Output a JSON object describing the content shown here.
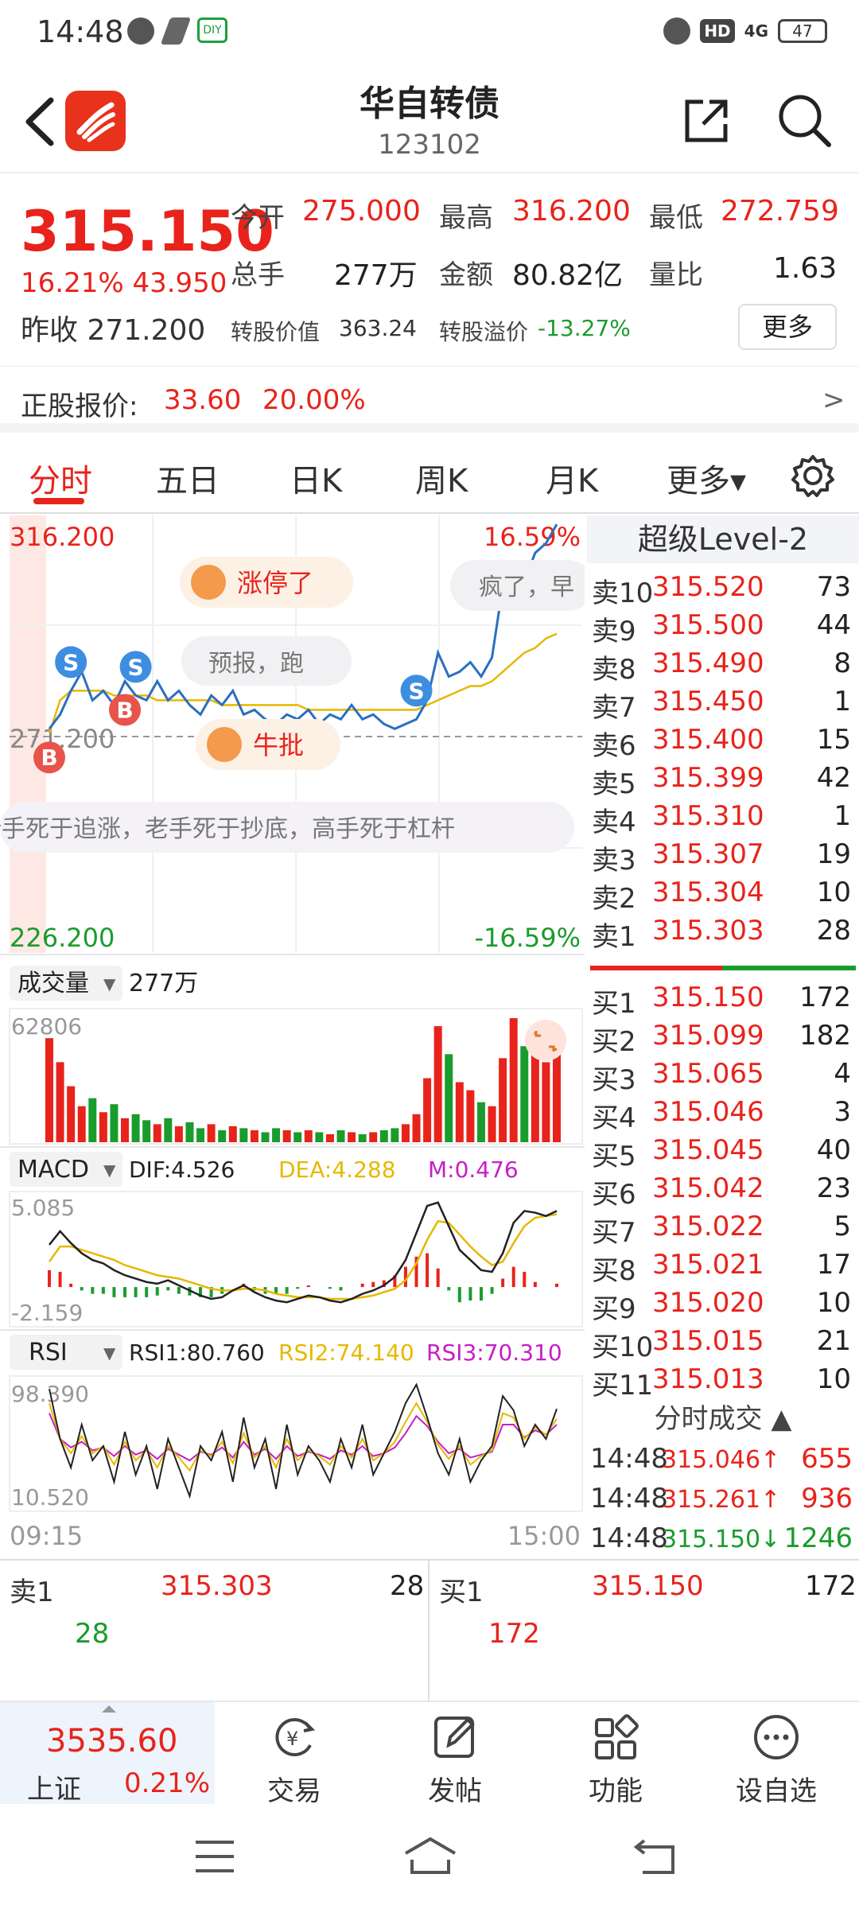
{
  "status_bar": {
    "time": "14:48",
    "battery": "47",
    "network": "4G",
    "hd": "HD"
  },
  "header": {
    "title": "华自转债",
    "code": "123102"
  },
  "quote": {
    "price": "315.150",
    "change_pct": "16.21%",
    "change_abs": "43.950",
    "prev_close_label": "昨收",
    "prev_close": "271.200",
    "open_label": "今开",
    "open": "275.000",
    "high_label": "最高",
    "high": "316.200",
    "low_label": "最低",
    "low": "272.759",
    "volume_label": "总手",
    "volume": "277万",
    "amount_label": "金额",
    "amount": "80.82亿",
    "ratio_label": "量比",
    "ratio": "1.63",
    "conv_value_label": "转股价值",
    "conv_value": "363.24",
    "premium_label": "转股溢价",
    "premium": "-13.27%",
    "more_label": "更多"
  },
  "underlying": {
    "label": "正股报价:",
    "price": "33.60",
    "pct": "20.00%",
    "arrow": ">"
  },
  "tabs": [
    {
      "label": "分时"
    },
    {
      "label": "五日"
    },
    {
      "label": "日K"
    },
    {
      "label": "周K"
    },
    {
      "label": "月K"
    },
    {
      "label": "更多▾"
    }
  ],
  "colors": {
    "up": "#e8231b",
    "down": "#1a9c2c",
    "price_line": "#2b6fc0",
    "avg_line": "#e6b800",
    "macd_dea": "#e6b800",
    "macd_m": "#c61ec6"
  },
  "chart_data": [
    {
      "type": "line",
      "title": "",
      "y_top_label": "316.200",
      "y_mid_label": "271.200",
      "y_bottom_label": "226.200",
      "pct_top_label": "16.59%",
      "pct_bottom_label": "-16.59%",
      "x_start_label": "09:15",
      "x_end_label": "15:00",
      "ylim": [
        226.2,
        316.2
      ],
      "series": [
        {
          "values": [
            273,
            276,
            281,
            285,
            279,
            281,
            278,
            283,
            280,
            279,
            283,
            279,
            281,
            278,
            276,
            280,
            278,
            281,
            276,
            277,
            275,
            274,
            276,
            275,
            277,
            274,
            276,
            275,
            278,
            275,
            276,
            274,
            273,
            274,
            275,
            279,
            289,
            284,
            285,
            287,
            284,
            288,
            303,
            308,
            304,
            310,
            312,
            316
          ]
        },
        {
          "values": [
            272,
            279,
            281,
            281,
            281,
            281,
            280,
            280,
            280,
            280,
            279,
            279,
            279,
            279,
            279,
            279,
            278,
            278,
            278,
            278,
            278,
            278,
            278,
            278,
            277,
            277,
            277,
            277,
            277,
            277,
            277,
            277,
            277,
            277,
            277,
            278,
            279,
            280,
            281,
            282,
            282,
            283,
            285,
            287,
            289,
            290,
            292,
            293
          ]
        }
      ],
      "markers": [
        {
          "label": "B",
          "index": 0
        },
        {
          "label": "S",
          "index": 2
        },
        {
          "label": "B",
          "index": 7
        },
        {
          "label": "S",
          "index": 8
        },
        {
          "label": "B",
          "index": 25
        },
        {
          "label": "S",
          "index": 34
        }
      ],
      "overlays": [
        "涨停了",
        "预报，跑",
        "牛批",
        "疯了，早",
        "新手死于追涨，老手死于抄底，高手死于杠杆"
      ]
    },
    {
      "type": "bar",
      "selector_label": "成交量",
      "total_label": "277万",
      "y_top_label": "62806",
      "values": [
        52000,
        40000,
        28000,
        18000,
        22000,
        15000,
        19000,
        12000,
        14000,
        11000,
        9000,
        12000,
        8000,
        10000,
        7000,
        9000,
        6000,
        8000,
        7000,
        6000,
        5000,
        7000,
        6000,
        5000,
        6000,
        5000,
        4000,
        6000,
        5000,
        4000,
        5000,
        6000,
        7000,
        9000,
        14000,
        32000,
        58000,
        44000,
        30000,
        26000,
        20000,
        18000,
        42000,
        62000,
        48000,
        55000,
        40000,
        50000
      ]
    },
    {
      "type": "line",
      "selector_label": "MACD",
      "dif_label": "DIF:4.526",
      "dea_label": "DEA:4.288",
      "m_label": "M:0.476",
      "y_top_label": "5.085",
      "y_bottom_label": "-2.159",
      "ylim": [
        -2.159,
        5.085
      ],
      "series": [
        {
          "name": "DIF",
          "values": [
            2.5,
            3.3,
            2.6,
            2.0,
            1.6,
            1.4,
            1.0,
            0.7,
            0.5,
            0.3,
            0.2,
            0.4,
            0.1,
            -0.2,
            -0.5,
            -0.7,
            -0.6,
            -0.2,
            0.1,
            -0.3,
            -0.6,
            -0.8,
            -0.9,
            -0.7,
            -0.5,
            -0.6,
            -0.8,
            -0.9,
            -0.7,
            -0.4,
            -0.2,
            0.1,
            0.6,
            1.6,
            3.2,
            4.8,
            5.0,
            3.6,
            2.2,
            1.6,
            1.0,
            0.9,
            2.0,
            3.8,
            4.5,
            4.4,
            4.2,
            4.5
          ]
        },
        {
          "name": "DEA",
          "values": [
            1.5,
            2.4,
            2.4,
            2.2,
            2.0,
            1.8,
            1.6,
            1.3,
            1.1,
            0.9,
            0.7,
            0.6,
            0.5,
            0.3,
            0.1,
            -0.1,
            -0.2,
            -0.2,
            -0.1,
            -0.1,
            -0.2,
            -0.4,
            -0.5,
            -0.6,
            -0.6,
            -0.6,
            -0.7,
            -0.7,
            -0.7,
            -0.6,
            -0.5,
            -0.3,
            -0.1,
            0.4,
            1.4,
            2.8,
            3.9,
            3.8,
            3.1,
            2.4,
            1.8,
            1.3,
            1.5,
            2.6,
            3.6,
            4.1,
            4.2,
            4.3
          ]
        },
        {
          "name": "M",
          "values": [
            1.0,
            0.9,
            0.2,
            -0.2,
            -0.4,
            -0.4,
            -0.6,
            -0.6,
            -0.6,
            -0.6,
            -0.5,
            -0.2,
            -0.4,
            -0.5,
            -0.6,
            -0.6,
            -0.4,
            0.0,
            0.2,
            -0.2,
            -0.4,
            -0.4,
            -0.4,
            -0.1,
            0.1,
            0.0,
            -0.1,
            -0.2,
            0.0,
            0.2,
            0.3,
            0.4,
            0.7,
            1.2,
            1.8,
            2.0,
            1.1,
            -0.2,
            -0.9,
            -0.8,
            -0.8,
            -0.4,
            0.5,
            1.2,
            0.9,
            0.3,
            0.0,
            0.2
          ]
        }
      ]
    },
    {
      "type": "line",
      "selector_label": "RSI",
      "rsi1_label": "RSI1:80.760",
      "rsi2_label": "RSI2:74.140",
      "rsi3_label": "RSI3:70.310",
      "y_top_label": "98.390",
      "y_bottom_label": "10.520",
      "ylim": [
        10.52,
        98.39
      ],
      "series": [
        {
          "name": "RSI1",
          "values": [
            95,
            60,
            40,
            70,
            45,
            55,
            30,
            65,
            35,
            55,
            25,
            60,
            40,
            20,
            55,
            45,
            65,
            30,
            75,
            40,
            60,
            25,
            70,
            35,
            55,
            45,
            30,
            60,
            40,
            70,
            35,
            50,
            65,
            85,
            98,
            75,
            50,
            35,
            60,
            30,
            45,
            55,
            90,
            80,
            55,
            70,
            60,
            81
          ]
        },
        {
          "name": "RSI2",
          "values": [
            85,
            60,
            50,
            62,
            50,
            55,
            42,
            58,
            45,
            52,
            40,
            55,
            47,
            38,
            52,
            48,
            58,
            43,
            64,
            47,
            55,
            40,
            60,
            45,
            52,
            48,
            42,
            55,
            47,
            60,
            45,
            50,
            58,
            72,
            85,
            72,
            56,
            46,
            55,
            42,
            48,
            52,
            78,
            75,
            60,
            68,
            63,
            74
          ]
        },
        {
          "name": "RSI3",
          "values": [
            78,
            60,
            54,
            58,
            52,
            54,
            48,
            55,
            49,
            52,
            46,
            53,
            49,
            45,
            51,
            49,
            54,
            47,
            58,
            49,
            53,
            46,
            55,
            48,
            51,
            49,
            46,
            52,
            49,
            55,
            48,
            50,
            54,
            64,
            76,
            69,
            58,
            50,
            53,
            47,
            49,
            51,
            70,
            70,
            61,
            66,
            63,
            70
          ]
        }
      ]
    }
  ],
  "level2": {
    "title": "超级Level-2",
    "asks": [
      {
        "label": "卖10",
        "price": "315.520",
        "vol": "73"
      },
      {
        "label": "卖9",
        "price": "315.500",
        "vol": "44"
      },
      {
        "label": "卖8",
        "price": "315.490",
        "vol": "8"
      },
      {
        "label": "卖7",
        "price": "315.450",
        "vol": "1"
      },
      {
        "label": "卖6",
        "price": "315.400",
        "vol": "15"
      },
      {
        "label": "卖5",
        "price": "315.399",
        "vol": "42"
      },
      {
        "label": "卖4",
        "price": "315.310",
        "vol": "1"
      },
      {
        "label": "卖3",
        "price": "315.307",
        "vol": "19"
      },
      {
        "label": "卖2",
        "price": "315.304",
        "vol": "10"
      },
      {
        "label": "卖1",
        "price": "315.303",
        "vol": "28"
      }
    ],
    "bids": [
      {
        "label": "买1",
        "price": "315.150",
        "vol": "172"
      },
      {
        "label": "买2",
        "price": "315.099",
        "vol": "182"
      },
      {
        "label": "买3",
        "price": "315.065",
        "vol": "4"
      },
      {
        "label": "买4",
        "price": "315.046",
        "vol": "3"
      },
      {
        "label": "买5",
        "price": "315.045",
        "vol": "40"
      },
      {
        "label": "买6",
        "price": "315.042",
        "vol": "23"
      },
      {
        "label": "买7",
        "price": "315.022",
        "vol": "5"
      },
      {
        "label": "买8",
        "price": "315.021",
        "vol": "17"
      },
      {
        "label": "买9",
        "price": "315.020",
        "vol": "10"
      },
      {
        "label": "买10",
        "price": "315.015",
        "vol": "21"
      },
      {
        "label": "买11",
        "price": "315.013",
        "vol": "10"
      }
    ],
    "ticks_title": "分时成交 ▲",
    "ticks": [
      {
        "time": "14:48",
        "price": "315.046↑",
        "vol": "655",
        "dir": "up"
      },
      {
        "time": "14:48",
        "price": "315.261↑",
        "vol": "936",
        "dir": "up"
      },
      {
        "time": "14:48",
        "price": "315.150↓",
        "vol": "1246",
        "dir": "down"
      }
    ]
  },
  "book": {
    "ask_label": "卖1",
    "ask_price": "315.303",
    "ask_vol": "28",
    "ask_sub": "28",
    "bid_label": "买1",
    "bid_price": "315.150",
    "bid_vol": "172",
    "bid_sub": "172"
  },
  "bottom_nav": {
    "index_value": "3535.60",
    "index_name": "上证",
    "index_pct": "0.21%",
    "items": [
      {
        "label": "交易"
      },
      {
        "label": "发帖"
      },
      {
        "label": "功能"
      },
      {
        "label": "设自选"
      }
    ]
  }
}
